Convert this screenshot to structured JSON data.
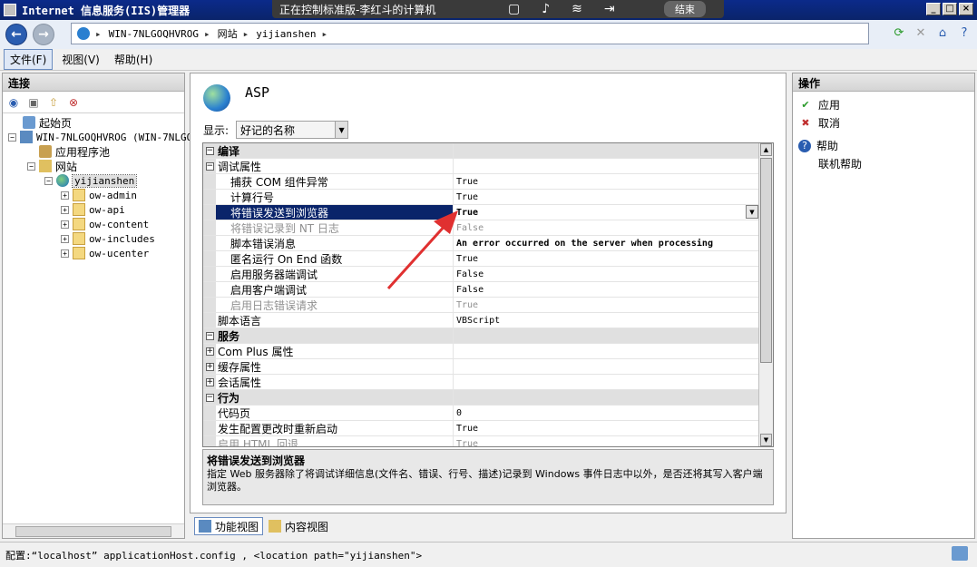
{
  "window": {
    "title": "Internet 信息服务(IIS)管理器"
  },
  "remote": {
    "title": "正在控制标准版-李红斗的计算机",
    "end_label": "结束"
  },
  "address": {
    "segments": [
      "WIN-7NLGOQHVROG",
      "网站",
      "yijianshen"
    ]
  },
  "menu": {
    "items": [
      "文件(F)",
      "视图(V)",
      "帮助(H)"
    ]
  },
  "left": {
    "header": "连接",
    "tree": {
      "start": "起始页",
      "server": "WIN-7NLGOQHVROG (WIN-7NLGO",
      "app_pools": "应用程序池",
      "sites": "网站",
      "site": "yijianshen",
      "folders": [
        "ow-admin",
        "ow-api",
        "ow-content",
        "ow-includes",
        "ow-ucenter"
      ]
    }
  },
  "center": {
    "title": "ASP",
    "display_label": "显示:",
    "display_value": "好记的名称",
    "grid": {
      "compile": "编译",
      "debug": "调试属性",
      "props": [
        {
          "name": "捕获 COM 组件异常",
          "value": "True"
        },
        {
          "name": "计算行号",
          "value": "True"
        },
        {
          "name": "将错误发送到浏览器",
          "value": "True"
        },
        {
          "name": "将错误记录到 NT 日志",
          "value": "False"
        },
        {
          "name": "脚本错误消息",
          "value": "An error occurred on the server when processing"
        },
        {
          "name": "匿名运行 On End 函数",
          "value": "True"
        },
        {
          "name": "启用服务器端调试",
          "value": "False"
        },
        {
          "name": "启用客户端调试",
          "value": "False"
        },
        {
          "name": "启用日志错误请求",
          "value": "True"
        }
      ],
      "script_lang": {
        "name": "脚本语言",
        "value": "VBScript"
      },
      "services": "服务",
      "service_items": [
        "Com Plus 属性",
        "缓存属性",
        "会话属性"
      ],
      "behavior": "行为",
      "behavior_items": [
        {
          "name": "代码页",
          "value": "0"
        },
        {
          "name": "发生配置更改时重新启动",
          "value": "True"
        },
        {
          "name": "启用 HTML 回退",
          "value": "True"
        }
      ]
    },
    "description": {
      "title": "将错误发送到浏览器",
      "text": "指定 Web 服务器除了将调试详细信息(文件名、错误、行号、描述)记录到 Windows 事件日志中以外，是否还将其写入客户端浏览器。"
    },
    "tabs": {
      "features": "功能视图",
      "content": "内容视图"
    }
  },
  "right": {
    "header": "操作",
    "apply": "应用",
    "cancel": "取消",
    "help": "帮助",
    "online_help": "联机帮助"
  },
  "status": {
    "text": "配置:“localhost” applicationHost.config , <location path=\"yijianshen\">"
  },
  "colors": {
    "accent": "#0a246a",
    "arrow": "#e03030"
  }
}
